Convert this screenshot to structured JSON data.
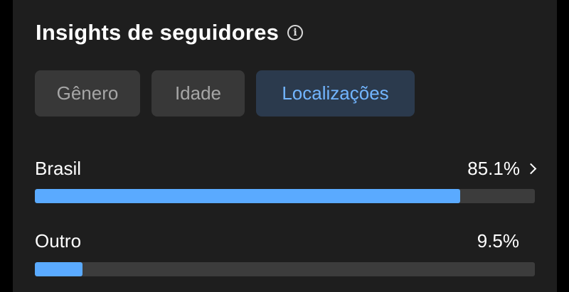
{
  "header": {
    "title": "Insights de seguidores",
    "info_icon": "info-icon"
  },
  "tabs": [
    {
      "label": "Gênero",
      "active": false
    },
    {
      "label": "Idade",
      "active": false
    },
    {
      "label": "Localizações",
      "active": true
    }
  ],
  "locations": [
    {
      "label": "Brasil",
      "value": "85.1%",
      "percent": 85.1,
      "has_chevron": true
    },
    {
      "label": "Outro",
      "value": "9.5%",
      "percent": 9.5,
      "has_chevron": false
    }
  ],
  "colors": {
    "bar_fill": "#5aaaff",
    "bar_track": "#3c3c3c",
    "active_tab_bg": "#2b3a4d",
    "active_tab_text": "#72b5ff",
    "panel_bg": "#1e1e1e"
  }
}
